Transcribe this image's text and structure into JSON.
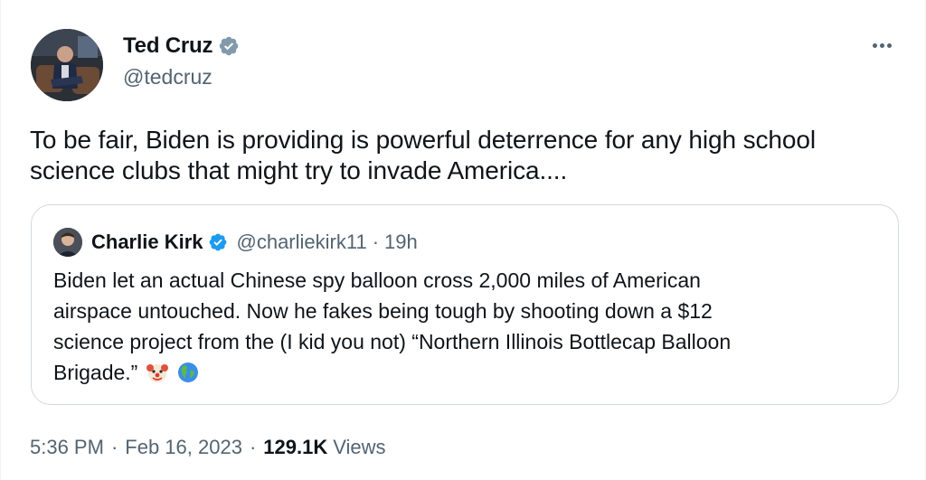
{
  "author": {
    "display_name": "Ted Cruz",
    "handle": "@tedcruz",
    "verified": true
  },
  "tweet": {
    "text_line1": "To be fair, Biden is providing is powerful deterrence for any high school",
    "text_line2": "science clubs that might try to invade America...."
  },
  "quote": {
    "display_name": "Charlie Kirk",
    "handle": "@charliekirk11",
    "separator": "·",
    "time": "19h",
    "verified": true,
    "text_line1": "Biden let an actual Chinese spy balloon cross 2,000 miles of American",
    "text_line2": "airspace untouched. Now he fakes being tough by shooting down a $12",
    "text_line3": "science project from the (I kid you not) “Northern Illinois Bottlecap Balloon",
    "text_line4": "Brigade.”",
    "emojis": [
      "clown-face-emoji",
      "globe-americas-emoji"
    ]
  },
  "meta": {
    "time": "5:36 PM",
    "dot1": "·",
    "date": "Feb 16, 2023",
    "dot2": "·",
    "views_count": "129.1K",
    "views_label": "Views"
  },
  "colors": {
    "verified_blue": "#1d9bf0",
    "gray_badge": "#829aab",
    "secondary_text": "#536471",
    "border": "#cfd9de"
  },
  "icons": {
    "more": "more-horizontal-icon"
  }
}
